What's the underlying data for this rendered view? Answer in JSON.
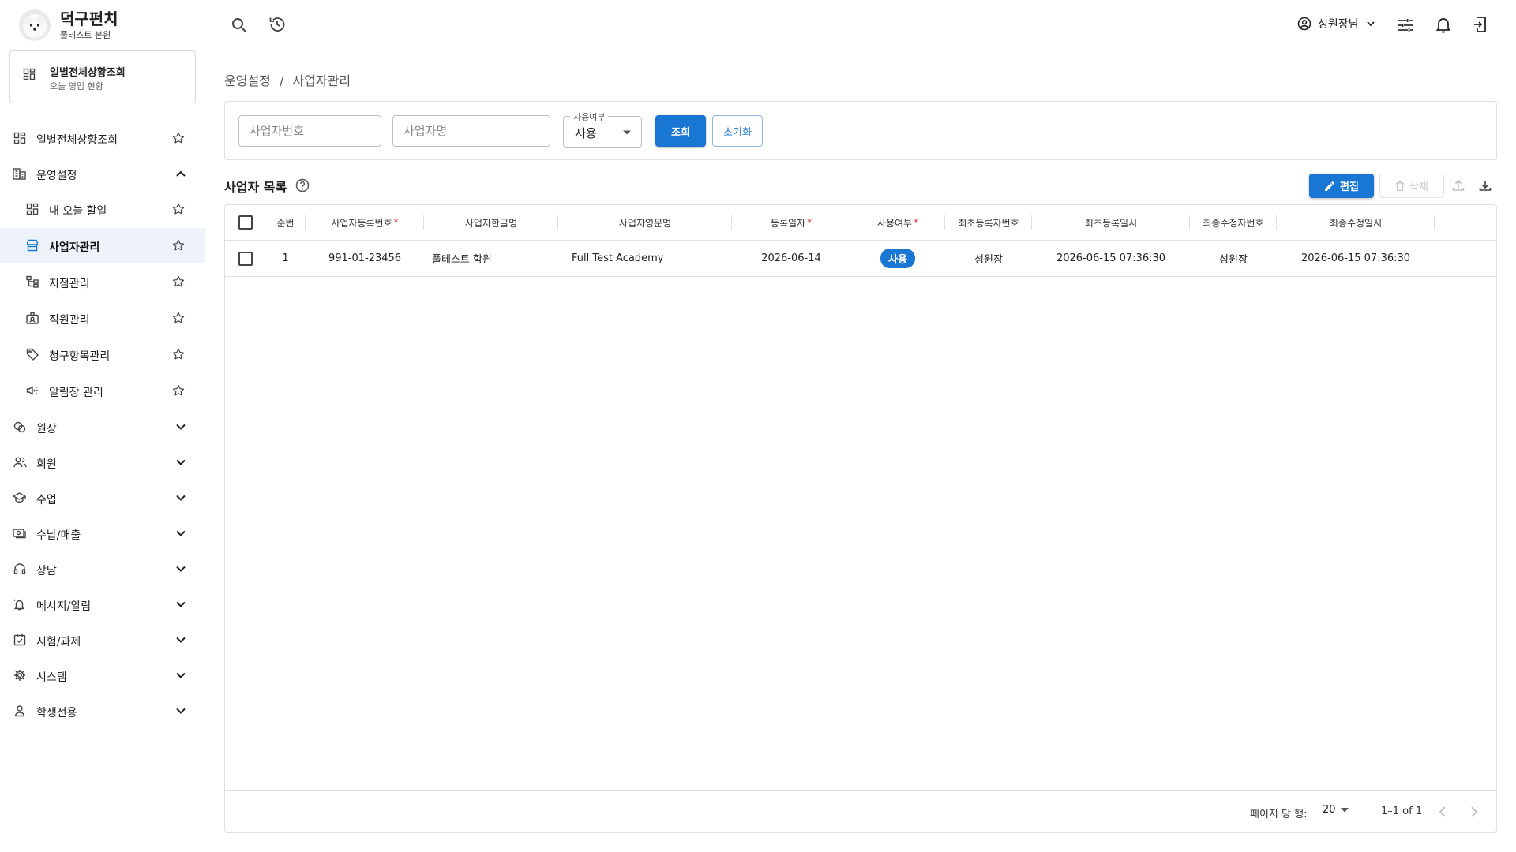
{
  "app": {
    "title": "덕구펀치",
    "subtitle": "풀테스트 본원"
  },
  "quick_card": {
    "title": "일별전체상황조회",
    "subtitle": "오늘 영업 현황"
  },
  "sidebar": {
    "items": [
      {
        "label": "일별전체상황조회",
        "icon": "dashboard-icon"
      },
      {
        "label": "운영설정",
        "icon": "building-icon"
      },
      {
        "label": "내 오늘 할일",
        "icon": "dashboard-icon"
      },
      {
        "label": "사업자관리",
        "icon": "store-icon"
      },
      {
        "label": "지점관리",
        "icon": "branch-icon"
      },
      {
        "label": "직원관리",
        "icon": "badge-icon"
      },
      {
        "label": "청구항목관리",
        "icon": "tag-icon"
      },
      {
        "label": "알림장 관리",
        "icon": "megaphone-icon"
      },
      {
        "label": "원장",
        "icon": "cash-stack-icon"
      },
      {
        "label": "회원",
        "icon": "people-icon"
      },
      {
        "label": "수업",
        "icon": "school-icon"
      },
      {
        "label": "수납/매출",
        "icon": "payments-icon"
      },
      {
        "label": "상담",
        "icon": "headset-icon"
      },
      {
        "label": "메시지/알림",
        "icon": "bell-ring-icon"
      },
      {
        "label": "시험/과제",
        "icon": "assignment-icon"
      },
      {
        "label": "시스템",
        "icon": "gear-icon"
      },
      {
        "label": "학생전용",
        "icon": "person-icon"
      }
    ]
  },
  "topbar": {
    "user": "성원장님"
  },
  "breadcrumb": {
    "parent": "운영설정",
    "sep": "/",
    "current": "사업자관리"
  },
  "filters": {
    "biz_no_placeholder": "사업자번호",
    "biz_name_placeholder": "사업자명",
    "status_label": "사용여부",
    "status_value": "사용",
    "search_label": "조회",
    "reset_label": "초기화"
  },
  "list": {
    "title": "사업자 목록",
    "edit_label": "편집",
    "delete_label": "삭제"
  },
  "table": {
    "columns": [
      "순번",
      "사업자등록번호",
      "사업자한글명",
      "사업자영문명",
      "등록일자",
      "사용여부",
      "최초등록자번호",
      "최초등록일시",
      "최종수정자번호",
      "최종수정일시"
    ],
    "required_mark": "*",
    "rows": [
      {
        "seq": "1",
        "reg_no": "991-01-23456",
        "kor_name": "풀테스트 학원",
        "eng_name": "Full Test Academy",
        "reg_date": "2026-06-14",
        "status": "사용",
        "creator": "성원장",
        "created_at": "2026-06-15 07:36:30",
        "modifier": "성원장",
        "modified_at": "2026-06-15 07:36:30"
      }
    ]
  },
  "pagination": {
    "rows_label": "페이지 당 행:",
    "rows_value": "20",
    "range": "1–1 of 1"
  },
  "colors": {
    "primary": "#1976d2",
    "active_bg": "#eef3fb",
    "required": "#d32f2f"
  }
}
